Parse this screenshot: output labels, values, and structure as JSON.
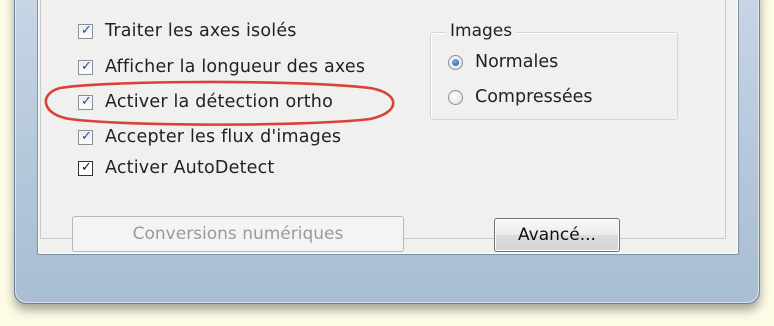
{
  "options": {
    "items": [
      {
        "label": "Traiter les axes isolés",
        "checked": true
      },
      {
        "label": "Afficher la longueur des axes",
        "checked": true
      },
      {
        "label": "Activer la détection ortho",
        "checked": true
      },
      {
        "label": "Accepter les flux d'images",
        "checked": true
      },
      {
        "label": "Activer AutoDetect",
        "checked": true
      }
    ]
  },
  "images_group": {
    "title": "Images",
    "options": [
      {
        "label": "Normales",
        "selected": true
      },
      {
        "label": "Compressées",
        "selected": false
      }
    ]
  },
  "buttons": {
    "conversions_label": "Conversions numériques",
    "conversions_enabled": false,
    "advanced_label": "Avancé..."
  },
  "annotation": {
    "highlight_color": "#d9413a",
    "highlighted_item": "Activer la détection ortho"
  },
  "colors": {
    "page_background": "#fdfbe6",
    "dialog_background": "#f0f0ee",
    "frame_blue": "#b3c6da",
    "checkmark": "#2d4a8a"
  }
}
